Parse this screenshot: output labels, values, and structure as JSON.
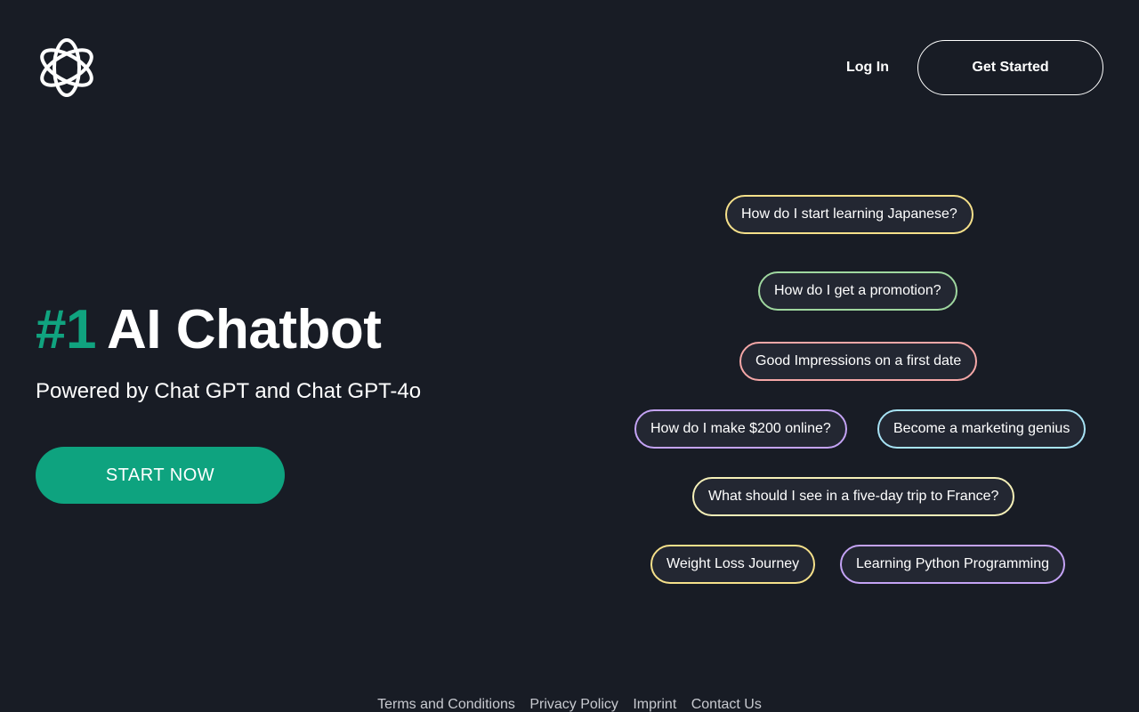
{
  "nav": {
    "logo_icon": "openai-knot-icon",
    "login_label": "Log In",
    "get_started_label": "Get Started"
  },
  "hero": {
    "rank": "#1",
    "title": "AI Chatbot",
    "subtitle": "Powered by Chat GPT and Chat GPT-4o",
    "cta_label": "START NOW",
    "accent_color": "#10a37f"
  },
  "prompts": [
    {
      "label": "How do I start learning Japanese?",
      "color": "#f5e08a"
    },
    {
      "label": "How do I get a promotion?",
      "color": "#9fd79f"
    },
    {
      "label": "Good Impressions on a first date",
      "color": "#f5a7a7"
    },
    {
      "label": "How do I make $200 online?",
      "color": "#c4a3f5"
    },
    {
      "label": "Become a marketing genius",
      "color": "#a7e3f5"
    },
    {
      "label": "What should I see in a five-day trip to France?",
      "color": "#f5f0b8"
    },
    {
      "label": "Weight Loss Journey",
      "color": "#f5e08a"
    },
    {
      "label": "Learning Python Programming",
      "color": "#c4a3f5"
    }
  ],
  "footer": {
    "links": [
      "Terms and Conditions",
      "Privacy Policy",
      "Imprint",
      "Contact Us"
    ]
  }
}
